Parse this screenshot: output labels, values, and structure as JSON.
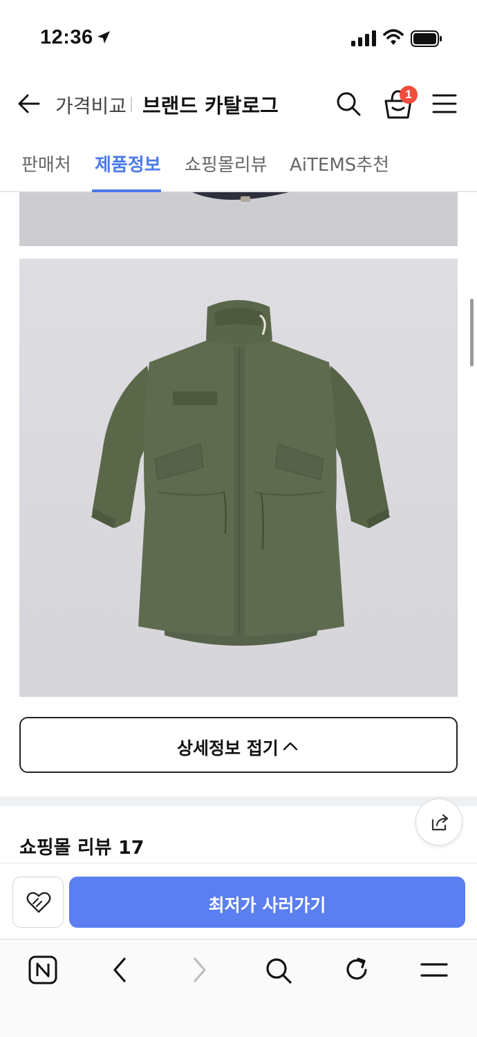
{
  "status_bar": {
    "time": "12:36"
  },
  "header": {
    "breadcrumb": "가격비교",
    "title": "브랜드 카탈로그",
    "cart_count": "1"
  },
  "tabs": [
    {
      "label": "판매처",
      "active": false
    },
    {
      "label": "제품정보",
      "active": true
    },
    {
      "label": "쇼핑몰리뷰",
      "active": false
    },
    {
      "label": "AiTEMS추천",
      "active": false
    }
  ],
  "content": {
    "fold_button_label": "상세정보 접기",
    "reviews_title": "쇼핑몰 리뷰 17"
  },
  "purchase_bar": {
    "buy_label": "최저가 사러가기"
  },
  "colors": {
    "accent": "#4a79e8",
    "buy_button": "#5b7ff0",
    "badge": "#f04c3c",
    "jacket": "#5e6b4e"
  },
  "icons": {
    "back": "arrow-left-icon",
    "search": "search-icon",
    "cart": "shopping-bag-icon",
    "menu": "hamburger-icon",
    "share": "share-icon",
    "wish": "heart-icon",
    "fold": "chevron-up-icon",
    "browser_home": "naver-n-icon",
    "browser_back": "chevron-left-icon",
    "browser_forward": "chevron-right-icon",
    "browser_search": "search-icon",
    "browser_reload": "reload-icon",
    "browser_menu": "menu-icon"
  }
}
